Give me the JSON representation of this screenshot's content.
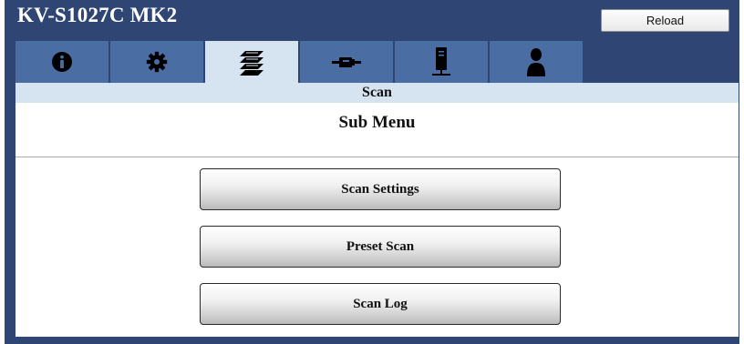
{
  "header": {
    "device_title": "KV-S1027C MK2",
    "reload_label": "Reload"
  },
  "tabs": [
    {
      "name": "info",
      "icon": "info-icon",
      "active": false
    },
    {
      "name": "settings",
      "icon": "gear-icon",
      "active": false
    },
    {
      "name": "scan",
      "icon": "scan-pages-icon",
      "active": true
    },
    {
      "name": "connection",
      "icon": "network-plug-icon",
      "active": false
    },
    {
      "name": "device",
      "icon": "network-device-icon",
      "active": false
    },
    {
      "name": "user",
      "icon": "user-icon",
      "active": false
    }
  ],
  "section": {
    "title": "Scan"
  },
  "submenu": {
    "title": "Sub Menu",
    "items": [
      {
        "label": "Scan Settings"
      },
      {
        "label": "Preset Scan"
      },
      {
        "label": "Scan Log"
      }
    ]
  },
  "colors": {
    "frame": "#2f4674",
    "tab": "#4a6da3",
    "tab_active": "#d6e3f1",
    "section_bar": "#d6e3f1"
  }
}
